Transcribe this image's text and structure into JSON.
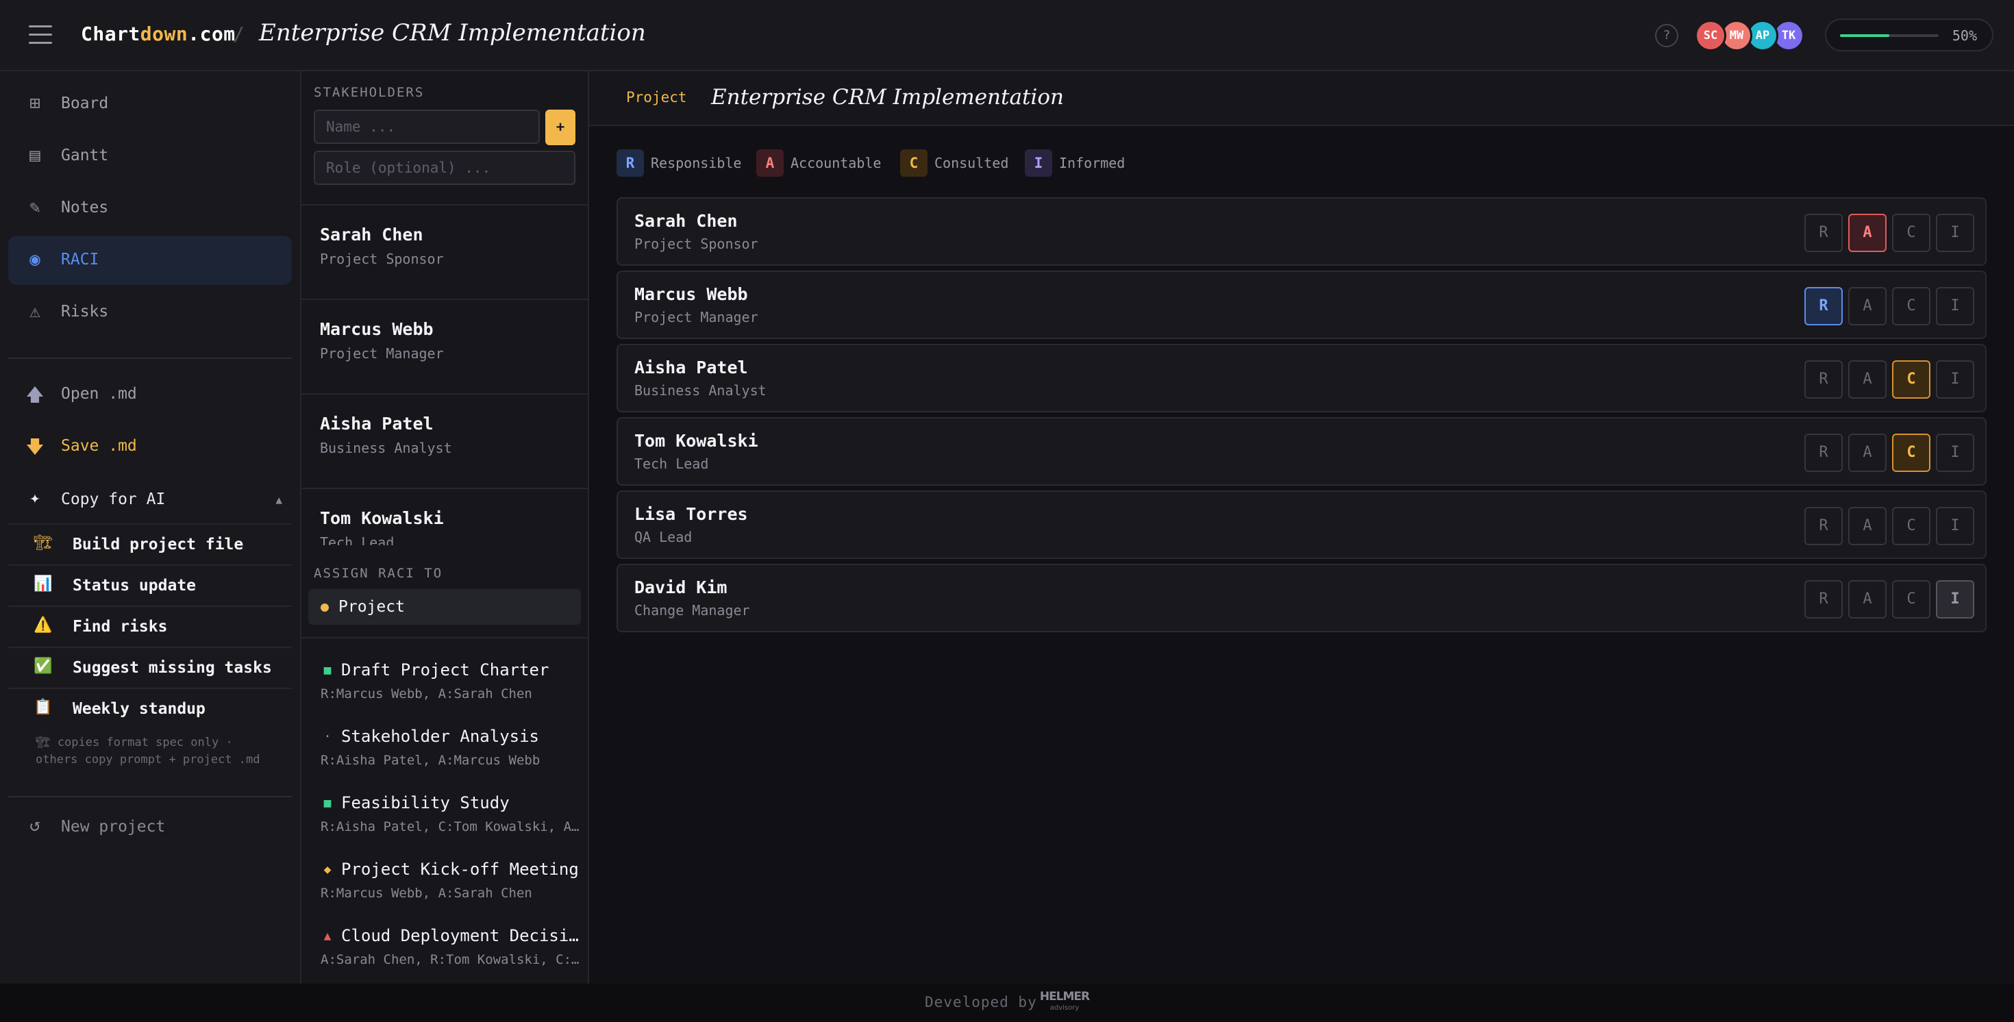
{
  "topbar": {
    "logo_part1": "Chart",
    "logo_part2": "down",
    "logo_part3": ".com",
    "separator": "/",
    "project_title": "Enterprise CRM Implementation",
    "help_label": "?",
    "avatars": [
      {
        "initials": "SC",
        "color": "#e55b5b"
      },
      {
        "initials": "MW",
        "color": "#f07a72"
      },
      {
        "initials": "AP",
        "color": "#22b8cf"
      },
      {
        "initials": "TK",
        "color": "#7b6cf0"
      }
    ],
    "progress": {
      "value": 0.5,
      "label": "50%",
      "color": "#3ecf8e"
    }
  },
  "sidebar": {
    "nav": [
      {
        "icon": "grid-icon",
        "glyph": "⊞",
        "label": "Board"
      },
      {
        "icon": "gantt-icon",
        "glyph": "▤",
        "label": "Gantt"
      },
      {
        "icon": "pencil-icon",
        "glyph": "✎",
        "label": "Notes"
      },
      {
        "icon": "target-icon",
        "glyph": "◉",
        "label": "RACI",
        "active": true
      },
      {
        "icon": "warning-icon",
        "glyph": "⚠",
        "label": "Risks"
      }
    ],
    "open_label": "Open .md",
    "save_label": "Save .md",
    "copy_ai_label": "Copy for AI",
    "copy_ai_caret": "▲",
    "ai_items": [
      {
        "icon": "crane-icon",
        "glyph": "🏗",
        "label": "Build project file"
      },
      {
        "icon": "chart-icon",
        "glyph": "📊",
        "label": "Status update"
      },
      {
        "icon": "warning-icon",
        "glyph": "⚠️",
        "label": "Find risks"
      },
      {
        "icon": "check-icon",
        "glyph": "✅",
        "label": "Suggest missing tasks"
      },
      {
        "icon": "clipboard-icon",
        "glyph": "📋",
        "label": "Weekly standup"
      }
    ],
    "ai_note": "🏗 copies format spec only · others copy prompt + project .md",
    "new_project_label": "New project"
  },
  "stakeholders": {
    "section_label": "STAKEHOLDERS",
    "name_placeholder": "Name ...",
    "role_placeholder": "Role (optional) ...",
    "add_label": "+",
    "list": [
      {
        "name": "Sarah Chen",
        "role": "Project Sponsor"
      },
      {
        "name": "Marcus Webb",
        "role": "Project Manager"
      },
      {
        "name": "Aisha Patel",
        "role": "Business Analyst"
      },
      {
        "name": "Tom Kowalski",
        "role": "Tech Lead"
      }
    ],
    "assign_label": "ASSIGN RACI TO",
    "assign_value": "Project",
    "tasks": [
      {
        "marker": "■",
        "marker_color": "#3ecf8e",
        "title": "Draft Project Charter",
        "meta": "R:Marcus Webb, A:Sarah Chen"
      },
      {
        "marker": "·",
        "marker_color": "#9a9aa5",
        "title": "Stakeholder Analysis",
        "meta": "R:Aisha Patel, A:Marcus Webb"
      },
      {
        "marker": "■",
        "marker_color": "#3ecf8e",
        "title": "Feasibility Study",
        "meta": "R:Aisha Patel, C:Tom Kowalski, A:Marcus Webb"
      },
      {
        "marker": "◆",
        "marker_color": "#f2b84b",
        "title": "Project Kick-off Meeting",
        "meta": "R:Marcus Webb, A:Sarah Chen"
      },
      {
        "marker": "▲",
        "marker_color": "#e15b5b",
        "title": "Cloud Deployment Decision",
        "meta": "A:Sarah Chen, R:Tom Kowalski, C:Aisha Patel"
      }
    ]
  },
  "main": {
    "tag": "Project",
    "title": "Enterprise CRM Implementation",
    "legend": [
      {
        "letter": "R",
        "text": "Responsible",
        "bg": "#1f2c47",
        "fg": "#7aa6ff"
      },
      {
        "letter": "A",
        "text": "Accountable",
        "bg": "#3d1d22",
        "fg": "#ff8080"
      },
      {
        "letter": "C",
        "text": "Consulted",
        "bg": "#3a2a12",
        "fg": "#f2b84b"
      },
      {
        "letter": "I",
        "text": "Informed",
        "bg": "#2a2440",
        "fg": "#b39dfa"
      }
    ],
    "cell_letters": [
      "R",
      "A",
      "C",
      "I"
    ],
    "rows": [
      {
        "name": "Sarah Chen",
        "role": "Project Sponsor",
        "assigned": "A"
      },
      {
        "name": "Marcus Webb",
        "role": "Project Manager",
        "assigned": "R"
      },
      {
        "name": "Aisha Patel",
        "role": "Business Analyst",
        "assigned": "C"
      },
      {
        "name": "Tom Kowalski",
        "role": "Tech Lead",
        "assigned": "C"
      },
      {
        "name": "Lisa Torres",
        "role": "QA Lead",
        "assigned": ""
      },
      {
        "name": "David Kim",
        "role": "Change Manager",
        "assigned": "I"
      }
    ]
  },
  "footer": {
    "developed_by": "Developed by",
    "logo_main": "HELMER",
    "logo_sub": "advisory"
  }
}
